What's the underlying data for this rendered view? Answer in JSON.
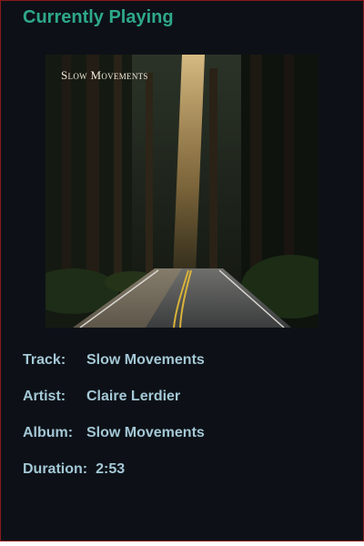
{
  "header": {
    "title": "Currently Playing"
  },
  "album_art": {
    "text": "Slow Movements"
  },
  "details": {
    "track_label": "Track:",
    "track_value": "Slow Movements",
    "artist_label": "Artist:",
    "artist_value": "Claire Lerdier",
    "album_label": "Album:",
    "album_value": "Slow Movements",
    "duration_label": "Duration:",
    "duration_value": "2:53"
  },
  "colors": {
    "background": "#0d1117",
    "title": "#2ea889",
    "text": "#a4c8d6",
    "border": "#8b1a1a"
  }
}
